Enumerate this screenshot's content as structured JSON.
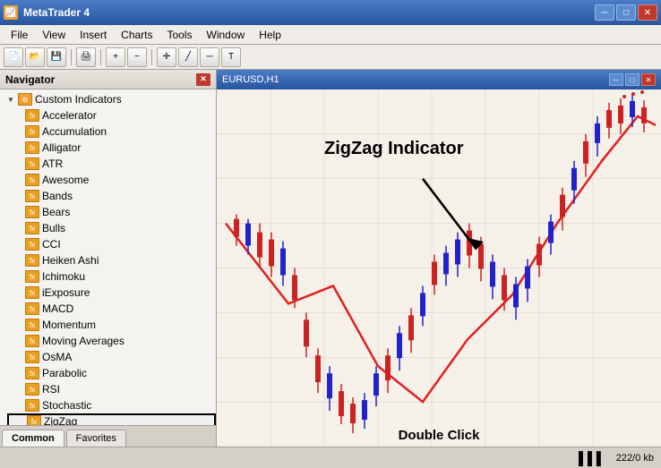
{
  "window": {
    "title": "MetaTrader 4",
    "title_controls": {
      "minimize": "─",
      "maximize": "□",
      "close": "✕"
    }
  },
  "menu": {
    "items": [
      "File",
      "View",
      "Insert",
      "Charts",
      "Tools",
      "Window",
      "Help"
    ]
  },
  "chart_title": {
    "label": "EURUSD,H1",
    "controls": [
      "─",
      "□",
      "✕"
    ]
  },
  "navigator": {
    "title": "Navigator",
    "sections": {
      "custom_indicators": {
        "label": "Custom Indicators",
        "items": [
          "Accelerator",
          "Accumulation",
          "Alligator",
          "ATR",
          "Awesome",
          "Bands",
          "Bears",
          "Bulls",
          "CCI",
          "Heiken Ashi",
          "Ichimoku",
          "iExposure",
          "MACD",
          "Momentum",
          "Moving Averages",
          "OsMA",
          "Parabolic",
          "RSI",
          "Stochastic",
          "ZigZag"
        ]
      }
    },
    "tabs": [
      "Common",
      "Favorites"
    ]
  },
  "chart": {
    "zigzag_label": "ZigZag Indicator",
    "dblclick_label": "Double Click"
  },
  "status_bar": {
    "bars_icon": "▌▌▌",
    "memory": "222/0 kb"
  }
}
